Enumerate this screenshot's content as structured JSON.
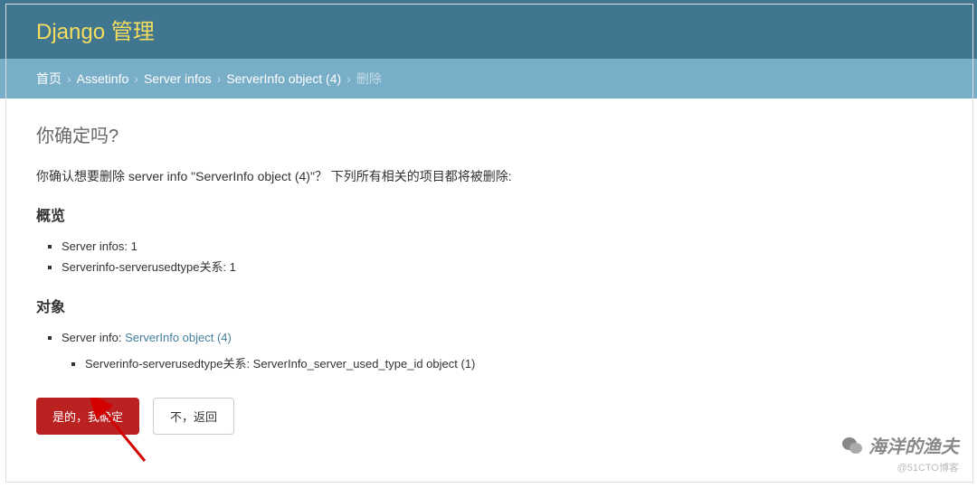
{
  "header": {
    "site_title": "Django 管理"
  },
  "breadcrumbs": {
    "home": "首页",
    "app": "Assetinfo",
    "model": "Server infos",
    "object": "ServerInfo object (4)",
    "current": "删除"
  },
  "page": {
    "title": "你确定吗?",
    "confirm_text": "你确认想要删除 server info \"ServerInfo object (4)\"？ 下列所有相关的项目都将被删除:"
  },
  "overview": {
    "heading": "概览",
    "items": [
      "Server infos: 1",
      "Serverinfo-serverusedtype关系: 1"
    ]
  },
  "objects": {
    "heading": "对象",
    "item_label": "Server info: ",
    "item_link": "ServerInfo object (4)",
    "sub_item": "Serverinfo-serverusedtype关系: ServerInfo_server_used_type_id object (1)"
  },
  "actions": {
    "confirm": "是的，我确定",
    "cancel": "不，返回"
  },
  "watermark": {
    "main": "海洋的渔夫",
    "sub": "@51CTO博客"
  }
}
